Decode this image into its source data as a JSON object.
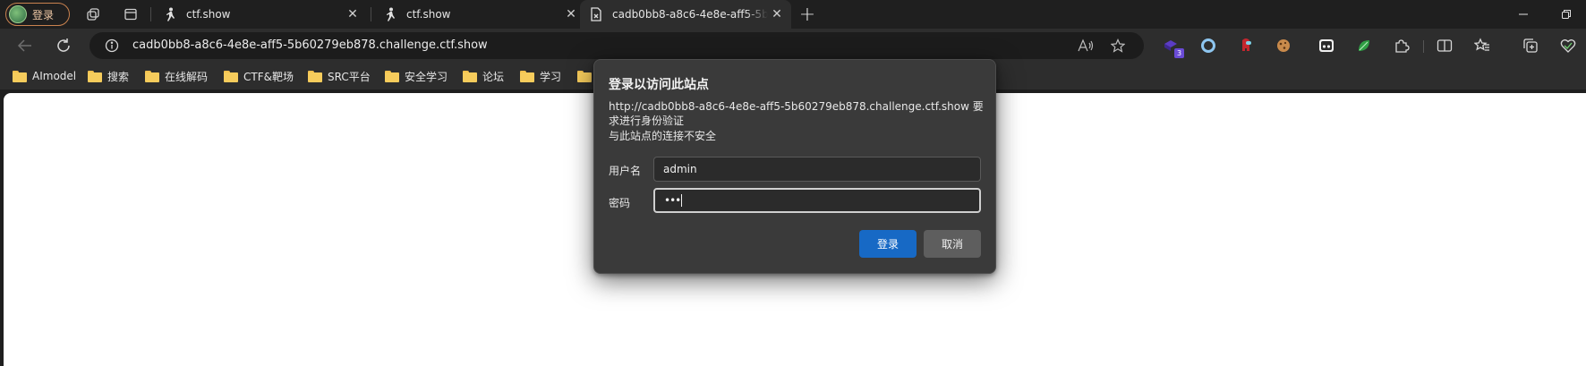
{
  "profile": {
    "label": "登录"
  },
  "tabs": [
    {
      "title": "ctf.show",
      "active": false
    },
    {
      "title": "ctf.show",
      "active": false
    },
    {
      "title": "cadb0bb8-a8c6-4e8e-aff5-5b60279eb878.challenge.ctf.show",
      "active": true
    }
  ],
  "address_bar": {
    "url": "cadb0bb8-a8c6-4e8e-aff5-5b60279eb878.challenge.ctf.show"
  },
  "extensions": [
    {
      "name": "extension-badge-icon",
      "badge": "3"
    }
  ],
  "bookmarks": [
    {
      "label": "AImodel"
    },
    {
      "label": "搜索"
    },
    {
      "label": "在线解码"
    },
    {
      "label": "CTF&靶场"
    },
    {
      "label": "SRC平台"
    },
    {
      "label": "安全学习"
    },
    {
      "label": "论坛"
    },
    {
      "label": "学习"
    }
  ],
  "auth_dialog": {
    "title": "登录以访问此站点",
    "message": "http://cadb0bb8-a8c6-4e8e-aff5-5b60279eb878.challenge.ctf.show 要求进行身份验证",
    "warning": "与此站点的连接不安全",
    "username_label": "用户名",
    "username_value": "admin",
    "password_label": "密码",
    "password_value": "•••",
    "login_button": "登录",
    "cancel_button": "取消"
  },
  "colors": {
    "primary_button": "#1769c5",
    "profile_border": "#c9824f",
    "folder": "#f6cc5c"
  }
}
